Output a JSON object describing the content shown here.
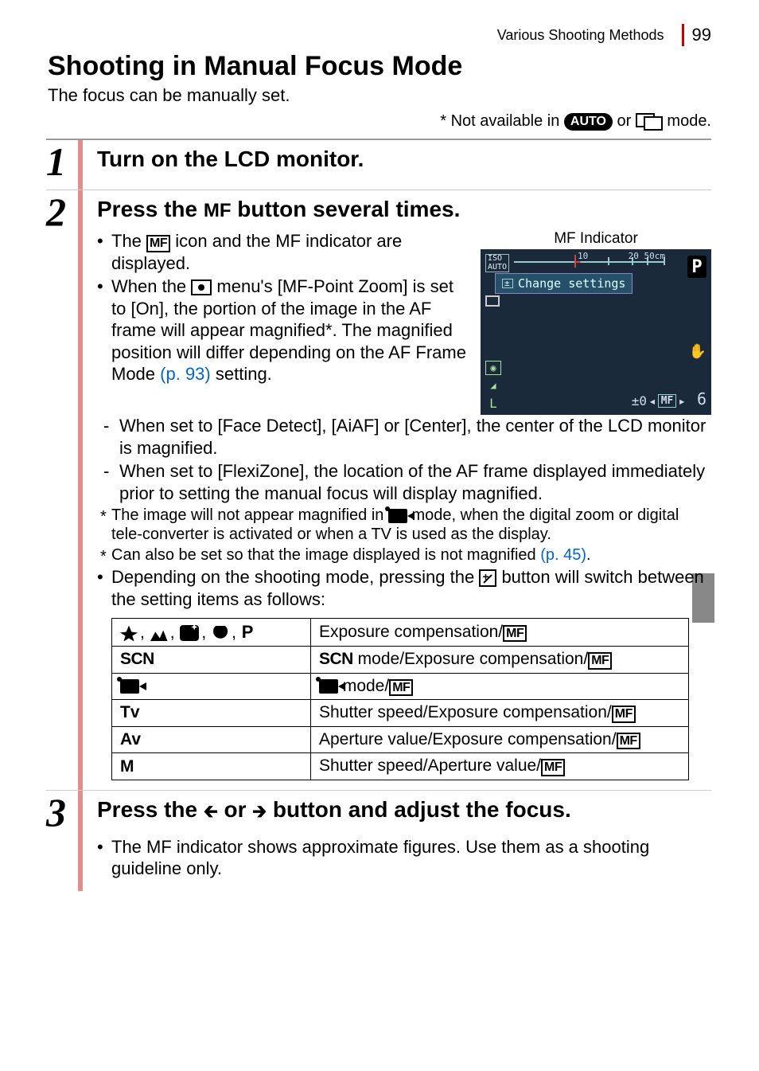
{
  "header": {
    "section": "Various Shooting Methods",
    "page": "99"
  },
  "title": "Shooting in Manual Focus Mode",
  "intro": "The focus can be manually set.",
  "note_prefix": "* Not available in ",
  "note_mid": " or ",
  "note_suffix": " mode.",
  "auto_label": "AUTO",
  "steps": {
    "s1": {
      "num": "1",
      "title": "Turn on the LCD monitor."
    },
    "s2": {
      "num": "2",
      "title_a": "Press the ",
      "title_mf": "MF",
      "title_b": " button several times.",
      "b1a": "The ",
      "b1b": " icon and the MF indicator are displayed.",
      "b2a": "When the ",
      "b2b": " menu's [MF-Point Zoom] is set to [On], the portion of the image in the AF frame will appear magnified*. The magnified position will differ depending on the AF Frame Mode ",
      "b2_link": "(p. 93)",
      "b2c": " setting.",
      "sub1": "When set to [Face Detect], [AiAF] or [Center], the center of the LCD monitor is magnified.",
      "sub2": "When set to [FlexiZone], the location of the AF frame displayed immediately prior to setting the manual focus will display magnified.",
      "star1a": "The image will not appear magnified in ",
      "star1b": " mode, when the digital zoom or digital tele-converter is activated or when a TV is used as the display.",
      "star2a": "Can also be set so that the image displayed is not magnified ",
      "star2_link": "(p. 45)",
      "star2b": ".",
      "b3a": "Depending on the shooting mode, pressing the ",
      "b3b": " button will switch between the setting items as follows:",
      "mf_indicator_label": "MF Indicator",
      "lcd": {
        "iso_top": "ISO",
        "iso_bottom": "AUTO",
        "scale_a": "10",
        "scale_b": "20 50cm",
        "p": "P",
        "popup": "Change settings",
        "exp": "±0",
        "mf": "MF",
        "six": "6"
      },
      "table": {
        "r1_mode_p": "P",
        "r1_right": "Exposure compensation/",
        "r2_left": "SCN",
        "r2_right_a": " mode/Exposure compensation/",
        "r3_right": " mode/",
        "r4_left": "Tv",
        "r4_right": "Shutter speed/Exposure compensation/",
        "r5_left": "Av",
        "r5_right": "Aperture value/Exposure compensation/",
        "r6_left": "M",
        "r6_right": "Shutter speed/Aperture value/"
      }
    },
    "s3": {
      "num": "3",
      "title_a": "Press the ",
      "title_b": " or ",
      "title_c": " button and adjust the focus.",
      "b1": "The MF indicator shows approximate figures. Use them as a shooting guideline only."
    }
  }
}
